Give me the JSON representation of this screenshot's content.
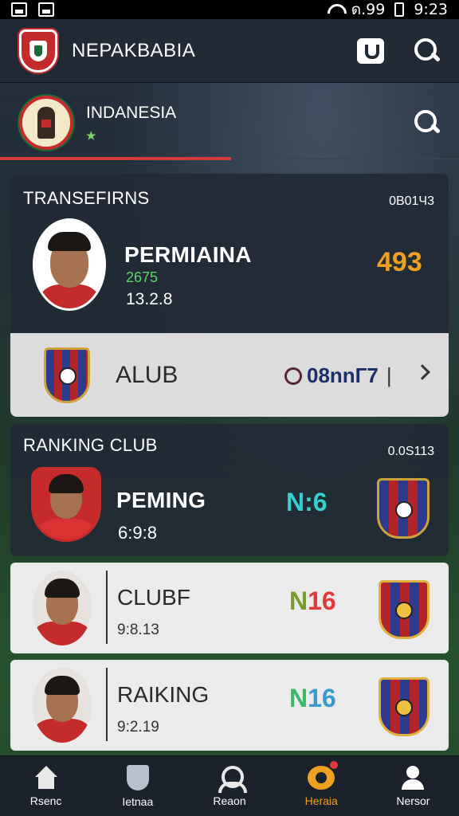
{
  "status_bar": {
    "signal_text": "ด.99",
    "time": "9:23"
  },
  "header": {
    "title": "NEPAKBABIA",
    "icons": [
      "shield-logo",
      "bag-icon",
      "search-icon"
    ]
  },
  "team": {
    "name": "INDANESIA",
    "sub": "★"
  },
  "transfers": {
    "title": "TRANSEFIRNS",
    "code": "0B01Ч3",
    "player": {
      "name": "PERMIAINA",
      "stat_a": "2675",
      "stat_b": "13.2.8",
      "score": "493"
    },
    "club": {
      "label": "ALUB",
      "code": "08nnГ7",
      "separator": "|"
    }
  },
  "ranking": {
    "title": "RANKING CLUB",
    "code": "0.0S113",
    "featured": {
      "name": "PEMING",
      "time": "6:9:8",
      "score": "N:6"
    },
    "list": [
      {
        "name": "CLUBF",
        "time": "9:8.13",
        "score_prefix": "N",
        "score_value": "16"
      },
      {
        "name": "RAIKING",
        "time": "9:2.19",
        "score_prefix": "N",
        "score_value": "16"
      }
    ]
  },
  "bottom_nav": [
    {
      "label": "Rsenc",
      "icon": "home-icon",
      "active": false
    },
    {
      "label": "Ietnaa",
      "icon": "shield-icon",
      "active": false
    },
    {
      "label": "Reaon",
      "icon": "person-icon",
      "active": false
    },
    {
      "label": "Heraia",
      "icon": "bell-icon",
      "active": true
    },
    {
      "label": "Nersor",
      "icon": "user-icon",
      "active": false
    }
  ],
  "colors": {
    "accent_red": "#d33a3a",
    "score_orange": "#f0a020",
    "score_teal": "#36d0d0",
    "nav_active": "#f0a020"
  }
}
